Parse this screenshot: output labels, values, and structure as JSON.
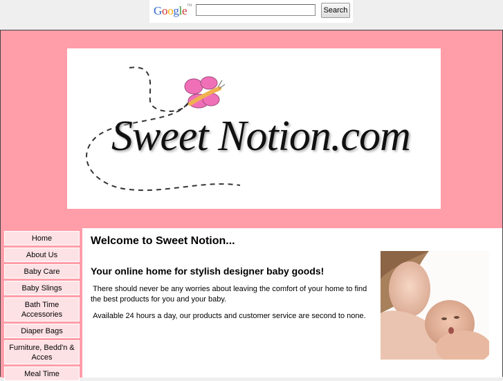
{
  "google": {
    "logo_text": "Google",
    "logo_tm": "TM",
    "search_value": "",
    "search_button": "Search"
  },
  "banner": {
    "site_name": "Sweet Notion.com"
  },
  "nav": {
    "items": [
      {
        "label": "Home"
      },
      {
        "label": "About Us"
      },
      {
        "label": "Baby Care"
      },
      {
        "label": "Baby Slings"
      },
      {
        "label": "Bath Time Accessories"
      },
      {
        "label": "Diaper Bags"
      },
      {
        "label": "Furniture, Bedd'n & Acces"
      },
      {
        "label": "Meal Time"
      }
    ]
  },
  "main": {
    "title": "Welcome to Sweet Notion...",
    "subtitle": "Your online home for stylish designer baby goods!",
    "paragraph1": " There should never be any worries about leaving the comfort of your home to find the best products for you and your baby.",
    "paragraph2": " Available 24 hours a day, our products and customer service are second to none."
  },
  "colors": {
    "header_pink": "#ff9da8",
    "nav_item_bg": "#fde2e5",
    "butterfly_pink": "#f070b8",
    "butterfly_orange": "#f0b050"
  }
}
